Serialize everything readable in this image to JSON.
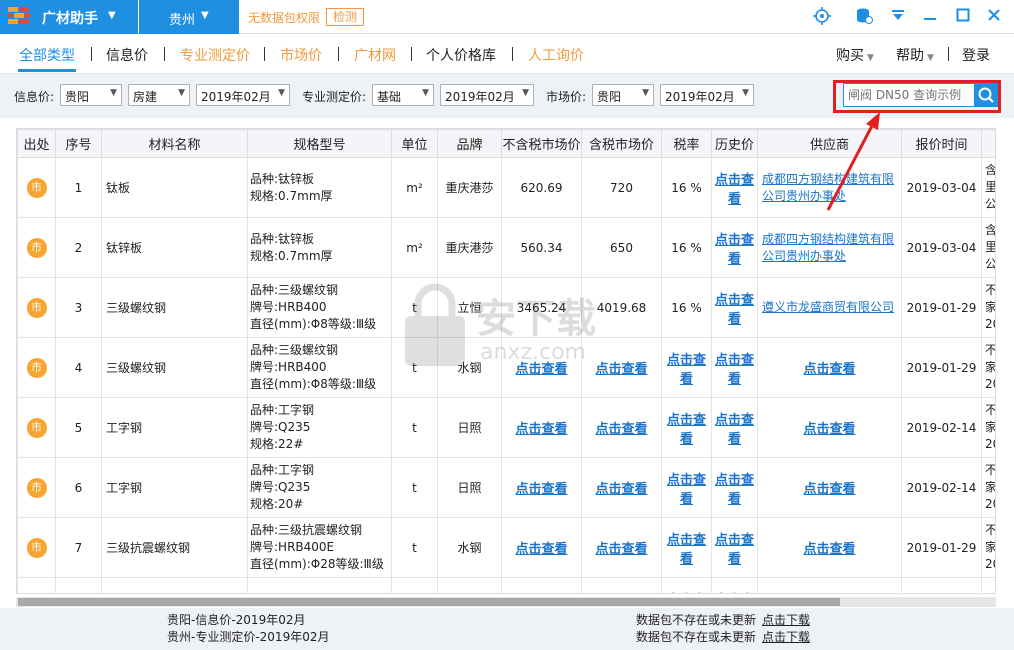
{
  "titlebar": {
    "app_name": "广材助手",
    "city": "贵州",
    "permission_text": "无数据包权限",
    "detect_button": "检测"
  },
  "nav": {
    "items": [
      {
        "label": "全部类型"
      },
      {
        "label": "信息价"
      },
      {
        "label": "专业测定价"
      },
      {
        "label": "市场价"
      },
      {
        "label": "广材网"
      },
      {
        "label": "个人价格库"
      },
      {
        "label": "人工询价"
      }
    ],
    "right": {
      "purchase": "购买",
      "help": "帮助",
      "login": "登录"
    }
  },
  "filters": {
    "info_label": "信息价:",
    "info_city": "贵阳",
    "info_category": "房建",
    "info_date": "2019年02月",
    "pro_label": "专业测定价:",
    "pro_type": "基础",
    "pro_date": "2019年02月",
    "market_label": "市场价:",
    "market_city": "贵阳",
    "market_date": "2019年02月",
    "search_placeholder": "闸阀 DN50 查询示例"
  },
  "table": {
    "headers": [
      "出处",
      "序号",
      "材料名称",
      "规格型号",
      "单位",
      "品牌",
      "不含税市场价",
      "含税市场价",
      "税率",
      "历史价",
      "供应商",
      "报价时间",
      ""
    ],
    "source_badge": "市",
    "link_text": "点击查看",
    "rows": [
      {
        "no": "1",
        "name": "钛板",
        "spec": [
          "品种:钛锌板",
          "规格:0.7mm厚"
        ],
        "unit": "m²",
        "brand": "重庆港莎",
        "price_ex": "620.69",
        "price_in": "720",
        "tax": "16 %",
        "history": "点击查看",
        "supplier": "成都四方钢结构建筑有限公司贵州办事处",
        "date": "2019-03-04",
        "extra": [
          "含",
          "里",
          "公"
        ]
      },
      {
        "no": "2",
        "name": "钛锌板",
        "spec": [
          "品种:钛锌板",
          "规格:0.7mm厚"
        ],
        "unit": "m²",
        "brand": "重庆港莎",
        "price_ex": "560.34",
        "price_in": "650",
        "tax": "16 %",
        "history": "点击查看",
        "supplier": "成都四方钢结构建筑有限公司贵州办事处",
        "date": "2019-03-04",
        "extra": [
          "含",
          "里",
          "公"
        ]
      },
      {
        "no": "3",
        "name": "三级螺纹钢",
        "spec": [
          "品种:三级螺纹钢",
          "牌号:HRB400",
          "直径(mm):Φ8等级:Ⅲ级"
        ],
        "unit": "t",
        "brand": "立恒",
        "price_ex": "3465.24",
        "price_in": "4019.68",
        "tax": "16 %",
        "history": "点击查看",
        "supplier": "遵义市龙盛商贸有限公司",
        "date": "2019-01-29",
        "extra": [
          "不",
          "家",
          "20"
        ]
      },
      {
        "no": "4",
        "name": "三级螺纹钢",
        "spec": [
          "品种:三级螺纹钢",
          "牌号:HRB400",
          "直径(mm):Φ8等级:Ⅲ级"
        ],
        "unit": "t",
        "brand": "水钢",
        "price_ex": "点击查看",
        "price_in": "点击查看",
        "tax": "点击查看",
        "history": "点击查看",
        "supplier": "点击查看",
        "date": "2019-01-29",
        "extra": [
          "不",
          "家",
          "20"
        ]
      },
      {
        "no": "5",
        "name": "工字钢",
        "spec": [
          "品种:工字钢",
          "牌号:Q235",
          "规格:22#"
        ],
        "unit": "t",
        "brand": "日照",
        "price_ex": "点击查看",
        "price_in": "点击查看",
        "tax": "点击查看",
        "history": "点击查看",
        "supplier": "点击查看",
        "date": "2019-02-14",
        "extra": [
          "不",
          "家",
          "20"
        ]
      },
      {
        "no": "6",
        "name": "工字钢",
        "spec": [
          "品种:工字钢",
          "牌号:Q235",
          "规格:20#"
        ],
        "unit": "t",
        "brand": "日照",
        "price_ex": "点击查看",
        "price_in": "点击查看",
        "tax": "点击查看",
        "history": "点击查看",
        "supplier": "点击查看",
        "date": "2019-02-14",
        "extra": [
          "不",
          "家",
          "20"
        ]
      },
      {
        "no": "7",
        "name": "三级抗震螺纹钢",
        "spec": [
          "品种:三级抗震螺纹钢",
          "牌号:HRB400E",
          "直径(mm):Φ28等级:Ⅲ级"
        ],
        "unit": "t",
        "brand": "水钢",
        "price_ex": "点击查看",
        "price_in": "点击查看",
        "tax": "点击查看",
        "history": "点击查看",
        "supplier": "点击查看",
        "date": "2019-01-29",
        "extra": [
          "不",
          "家",
          "20"
        ]
      },
      {
        "no": "",
        "name": "",
        "spec": [
          "品种:三级抗震螺纹钢",
          "",
          ""
        ],
        "unit": "",
        "brand": "",
        "price_ex": "",
        "price_in": "",
        "tax": "点击查看",
        "history": "点击查看",
        "supplier": "",
        "date": "",
        "extra": [
          "不",
          "",
          ""
        ]
      }
    ]
  },
  "status": {
    "line1_left": "贵阳-信息价-2019年02月",
    "line2_left": "贵州-专业测定价-2019年02月",
    "line1_right": "数据包不存在或未更新",
    "line2_right": "数据包不存在或未更新",
    "download_link": "点击下载"
  },
  "watermark": {
    "text": "安下载",
    "subtext": "anxz.com"
  },
  "colors": {
    "accent": "#1e8fe1",
    "orange": "#f29a3b",
    "link": "#1a74c9",
    "highlight": "#e02020"
  }
}
